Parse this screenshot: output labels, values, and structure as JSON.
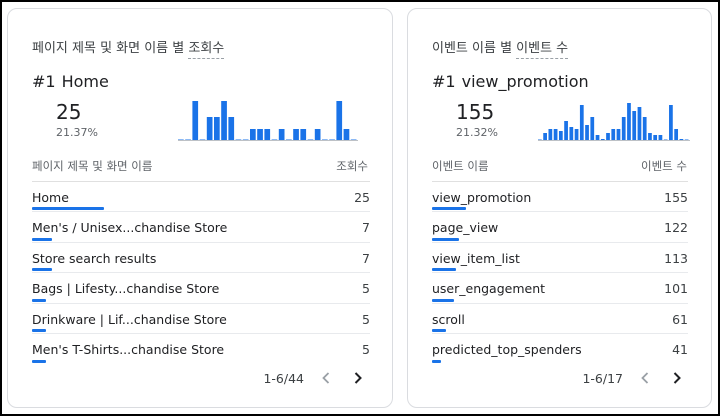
{
  "colors": {
    "accent": "#1a73e8"
  },
  "cards": [
    {
      "title_prefix": "페이지 제목 및 화면 이름 별",
      "title_metric": "조회수",
      "top_rank": "#1",
      "top_name": "Home",
      "top_value": "25",
      "top_pct": "21.37%",
      "sparkline": [
        0.03,
        0.03,
        1,
        0.03,
        0.6,
        0.6,
        1,
        0.6,
        0.03,
        0.03,
        0.3,
        0.3,
        0.3,
        0.03,
        0.3,
        0.03,
        0.3,
        0.3,
        0.03,
        0.3,
        0.03,
        0.03,
        1,
        0.3,
        0.03
      ],
      "col_name": "페이지 제목 및 화면 이름",
      "col_value": "조회수",
      "rows": [
        {
          "label": "Home",
          "value": "25",
          "bar": 1.0
        },
        {
          "label": "Men's / Unisex...chandise Store",
          "value": "7",
          "bar": 0.28
        },
        {
          "label": "Store search results",
          "value": "7",
          "bar": 0.28
        },
        {
          "label": "Bags | Lifesty...chandise Store",
          "value": "5",
          "bar": 0.2
        },
        {
          "label": "Drinkware | Lif...chandise Store",
          "value": "5",
          "bar": 0.2
        },
        {
          "label": "Men's T-Shirts...chandise Store",
          "value": "5",
          "bar": 0.2
        }
      ],
      "pager": "1-6/44"
    },
    {
      "title_prefix": "이벤트 이름 별",
      "title_metric": "이벤트 수",
      "top_rank": "#1",
      "top_name": "view_promotion",
      "top_value": "155",
      "top_pct": "21.32%",
      "sparkline": [
        0.03,
        0.2,
        0.3,
        0.3,
        0.25,
        0.5,
        0.35,
        0.3,
        0.9,
        0.4,
        0.6,
        0.15,
        0.05,
        0.2,
        0.3,
        0.3,
        0.6,
        0.95,
        0.75,
        0.85,
        0.6,
        0.2,
        0.15,
        0.15,
        0.03,
        0.9,
        0.3,
        0.05,
        0.03
      ],
      "col_name": "이벤트 이름",
      "col_value": "이벤트 수",
      "rows": [
        {
          "label": "view_promotion",
          "value": "155",
          "bar": 0.47
        },
        {
          "label": "page_view",
          "value": "122",
          "bar": 0.37
        },
        {
          "label": "view_item_list",
          "value": "113",
          "bar": 0.34
        },
        {
          "label": "user_engagement",
          "value": "101",
          "bar": 0.31
        },
        {
          "label": "scroll",
          "value": "61",
          "bar": 0.19
        },
        {
          "label": "predicted_top_spenders",
          "value": "41",
          "bar": 0.13
        }
      ],
      "pager": "1-6/17"
    }
  ]
}
